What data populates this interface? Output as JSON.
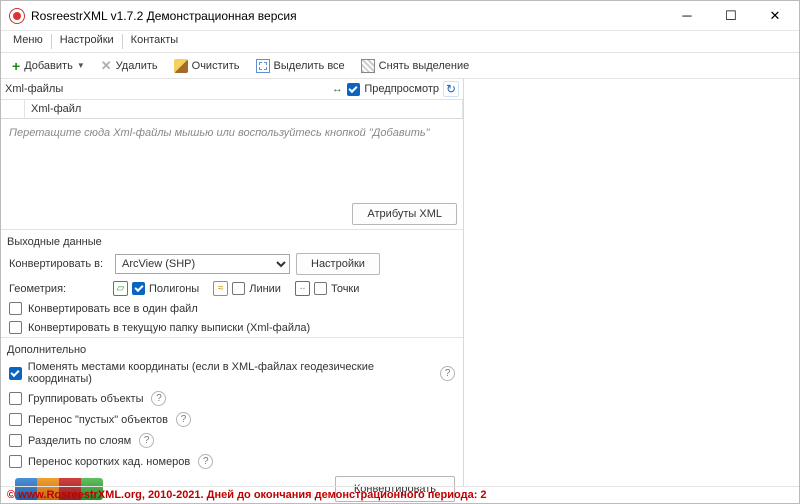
{
  "title": "RosreestrXML v1.7.2 Демонстрационная версия",
  "menu": {
    "m1": "Меню",
    "m2": "Настройки",
    "m3": "Контакты"
  },
  "toolbar": {
    "add": "Добавить",
    "del": "Удалить",
    "clear": "Очистить",
    "selall": "Выделить все",
    "desel": "Снять выделение"
  },
  "panel": {
    "xml_files": "Xml-файлы",
    "preview": "Предпросмотр",
    "col_file": "Xml-файл",
    "drop_hint": "Перетащите сюда Xml-файлы мышью или воспользуйтесь кнопкой \"Добавить\""
  },
  "buttons": {
    "attrs": "Атрибуты XML",
    "settings": "Настройки",
    "convert": "Конвертировать"
  },
  "out": {
    "section": "Выходные данные",
    "convert_to": "Конвертировать в:",
    "format": "ArcView (SHP)",
    "geometry": "Геометрия:",
    "polygons": "Полигоны",
    "lines": "Линии",
    "points": "Точки",
    "all_one": "Конвертировать все в один файл",
    "cur_folder": "Конвертировать в текущую папку выписки (Xml-файла)"
  },
  "extra": {
    "section": "Дополнительно",
    "swap": "Поменять местами координаты (если в XML-файлах геодезические координаты)",
    "group": "Группировать объекты",
    "empty": "Перенос \"пустых\" объектов",
    "layers": "Разделить по слоям",
    "short": "Перенос коротких кад. номеров"
  },
  "status": "© www.RosreestrXML.org, 2010-2021. Дней до окончания демонстрационного периода: 2"
}
